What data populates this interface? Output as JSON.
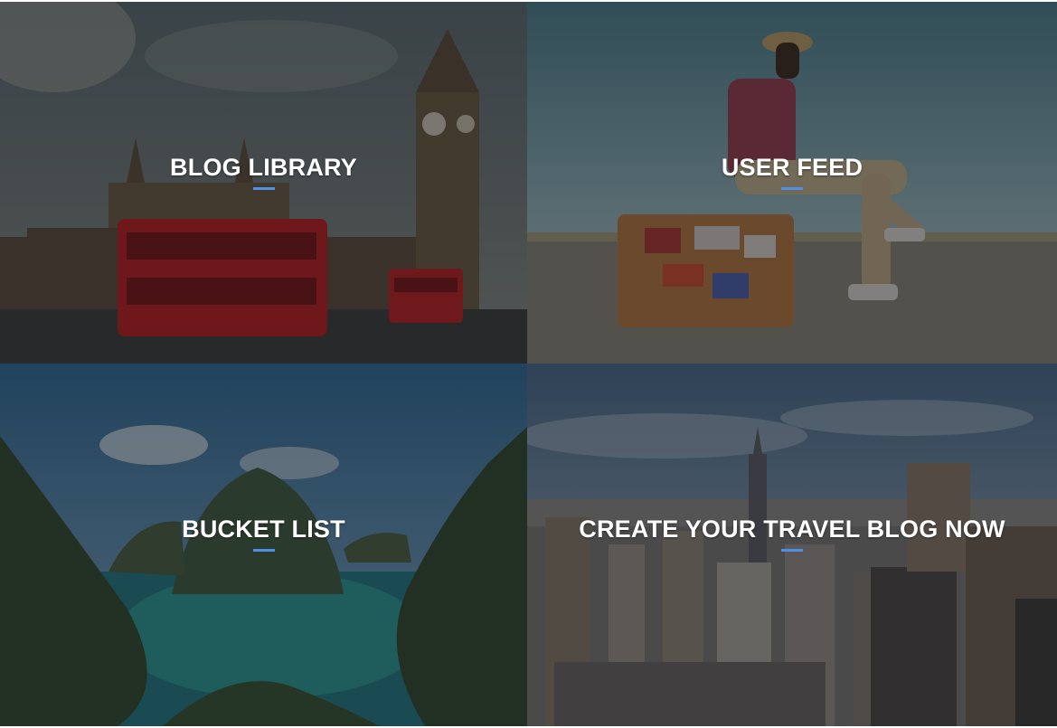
{
  "tiles": [
    {
      "id": "blog-library",
      "label": "BLOG LIBRARY"
    },
    {
      "id": "user-feed",
      "label": "USER FEED"
    },
    {
      "id": "bucket-list",
      "label": "BUCKET LIST"
    },
    {
      "id": "create-blog",
      "label": "CREATE YOUR TRAVEL BLOG NOW"
    }
  ],
  "colors": {
    "underline_accent": "#4f8fe6",
    "overlay": "rgba(20,22,30,0.48)"
  }
}
